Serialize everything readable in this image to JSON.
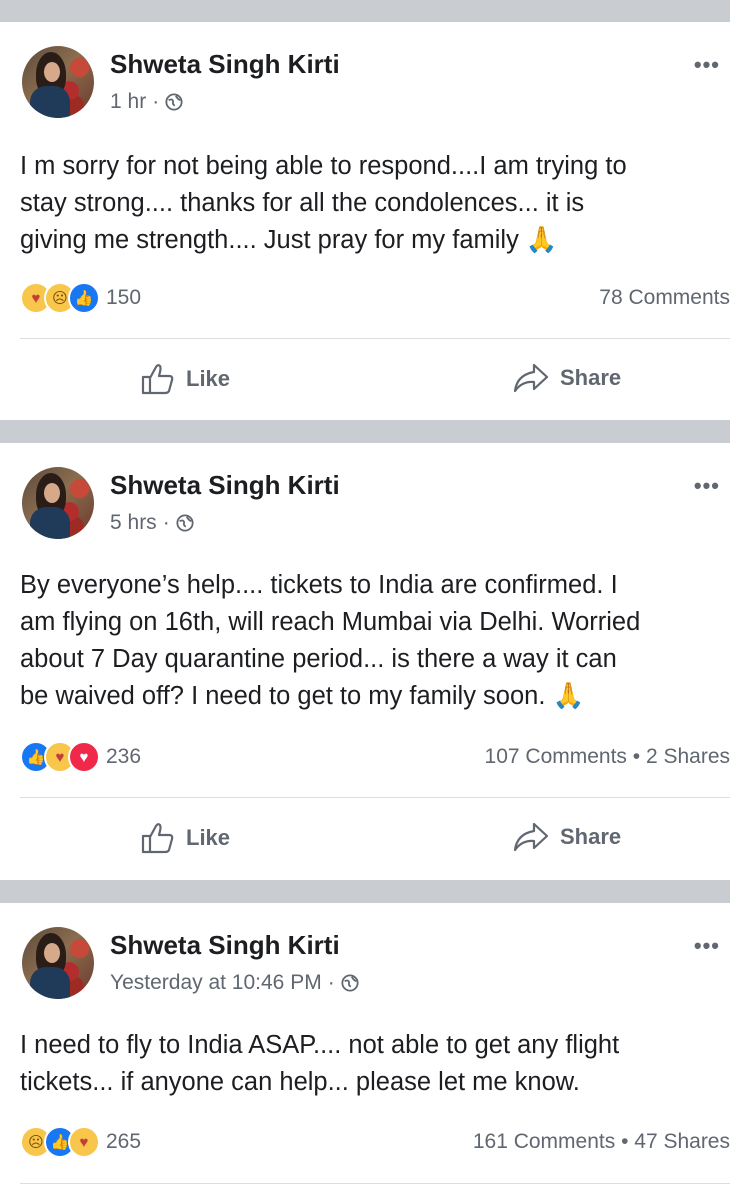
{
  "posts": [
    {
      "author": "Shweta Singh Kirti",
      "time": "1 hr",
      "separator": "·",
      "body_lines": [
        "I m sorry for not being able to respond....I am trying to",
        "stay strong.... thanks for all the condolences... it is",
        "giving me strength.... Just pray for my family 🙏"
      ],
      "reaction_icons": [
        "care-icon",
        "sad-icon",
        "like-icon"
      ],
      "reaction_count": "150",
      "stats": "78 Comments",
      "like_label": "Like",
      "share_label": "Share"
    },
    {
      "author": "Shweta Singh Kirti",
      "time": "5 hrs",
      "separator": "·",
      "body_lines": [
        "By everyone’s help.... tickets to India are confirmed. I",
        "am flying on 16th, will reach Mumbai via Delhi. Worried",
        "about 7 Day quarantine period... is there a way it can",
        "be waived off? I need to get to my family soon.  🙏"
      ],
      "reaction_icons": [
        "like-icon",
        "care-icon",
        "love-icon"
      ],
      "reaction_count": "236",
      "stats": "107 Comments • 2 Shares",
      "like_label": "Like",
      "share_label": "Share"
    },
    {
      "author": "Shweta Singh Kirti",
      "time": "Yesterday at 10:46 PM",
      "separator": "·",
      "body_lines": [
        "I need to fly to India ASAP.... not able to get any flight",
        "tickets... if anyone can help... please let me know."
      ],
      "reaction_icons": [
        "sad-icon",
        "like-icon",
        "care-icon"
      ],
      "reaction_count": "265",
      "stats": "161 Comments • 47 Shares"
    }
  ],
  "more_menu_glyph": "•••",
  "colors": {
    "feed_background": "#c9ccd1",
    "card_background": "#ffffff",
    "secondary_text": "#606770",
    "primary_text": "#1c1e21",
    "like_blue": "#1877f2",
    "love_red": "#f0284a",
    "emoji_yellow": "#f7c64a"
  }
}
